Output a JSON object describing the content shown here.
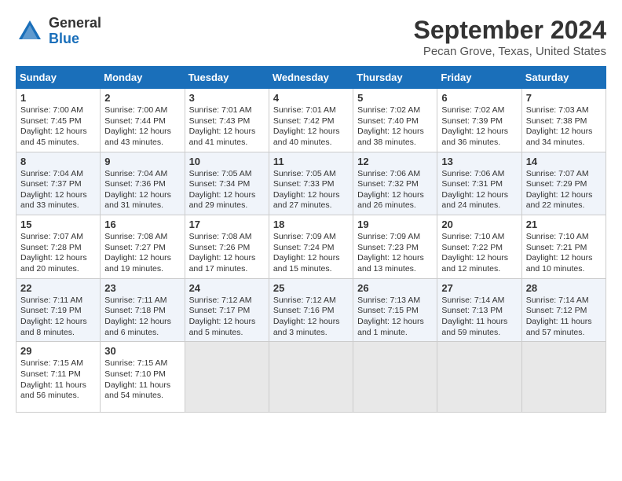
{
  "header": {
    "logo_general": "General",
    "logo_blue": "Blue",
    "title": "September 2024",
    "subtitle": "Pecan Grove, Texas, United States"
  },
  "weekdays": [
    "Sunday",
    "Monday",
    "Tuesday",
    "Wednesday",
    "Thursday",
    "Friday",
    "Saturday"
  ],
  "weeks": [
    [
      {
        "day": "1",
        "lines": [
          "Sunrise: 7:00 AM",
          "Sunset: 7:45 PM",
          "Daylight: 12 hours",
          "and 45 minutes."
        ]
      },
      {
        "day": "2",
        "lines": [
          "Sunrise: 7:00 AM",
          "Sunset: 7:44 PM",
          "Daylight: 12 hours",
          "and 43 minutes."
        ]
      },
      {
        "day": "3",
        "lines": [
          "Sunrise: 7:01 AM",
          "Sunset: 7:43 PM",
          "Daylight: 12 hours",
          "and 41 minutes."
        ]
      },
      {
        "day": "4",
        "lines": [
          "Sunrise: 7:01 AM",
          "Sunset: 7:42 PM",
          "Daylight: 12 hours",
          "and 40 minutes."
        ]
      },
      {
        "day": "5",
        "lines": [
          "Sunrise: 7:02 AM",
          "Sunset: 7:40 PM",
          "Daylight: 12 hours",
          "and 38 minutes."
        ]
      },
      {
        "day": "6",
        "lines": [
          "Sunrise: 7:02 AM",
          "Sunset: 7:39 PM",
          "Daylight: 12 hours",
          "and 36 minutes."
        ]
      },
      {
        "day": "7",
        "lines": [
          "Sunrise: 7:03 AM",
          "Sunset: 7:38 PM",
          "Daylight: 12 hours",
          "and 34 minutes."
        ]
      }
    ],
    [
      {
        "day": "8",
        "lines": [
          "Sunrise: 7:04 AM",
          "Sunset: 7:37 PM",
          "Daylight: 12 hours",
          "and 33 minutes."
        ]
      },
      {
        "day": "9",
        "lines": [
          "Sunrise: 7:04 AM",
          "Sunset: 7:36 PM",
          "Daylight: 12 hours",
          "and 31 minutes."
        ]
      },
      {
        "day": "10",
        "lines": [
          "Sunrise: 7:05 AM",
          "Sunset: 7:34 PM",
          "Daylight: 12 hours",
          "and 29 minutes."
        ]
      },
      {
        "day": "11",
        "lines": [
          "Sunrise: 7:05 AM",
          "Sunset: 7:33 PM",
          "Daylight: 12 hours",
          "and 27 minutes."
        ]
      },
      {
        "day": "12",
        "lines": [
          "Sunrise: 7:06 AM",
          "Sunset: 7:32 PM",
          "Daylight: 12 hours",
          "and 26 minutes."
        ]
      },
      {
        "day": "13",
        "lines": [
          "Sunrise: 7:06 AM",
          "Sunset: 7:31 PM",
          "Daylight: 12 hours",
          "and 24 minutes."
        ]
      },
      {
        "day": "14",
        "lines": [
          "Sunrise: 7:07 AM",
          "Sunset: 7:29 PM",
          "Daylight: 12 hours",
          "and 22 minutes."
        ]
      }
    ],
    [
      {
        "day": "15",
        "lines": [
          "Sunrise: 7:07 AM",
          "Sunset: 7:28 PM",
          "Daylight: 12 hours",
          "and 20 minutes."
        ]
      },
      {
        "day": "16",
        "lines": [
          "Sunrise: 7:08 AM",
          "Sunset: 7:27 PM",
          "Daylight: 12 hours",
          "and 19 minutes."
        ]
      },
      {
        "day": "17",
        "lines": [
          "Sunrise: 7:08 AM",
          "Sunset: 7:26 PM",
          "Daylight: 12 hours",
          "and 17 minutes."
        ]
      },
      {
        "day": "18",
        "lines": [
          "Sunrise: 7:09 AM",
          "Sunset: 7:24 PM",
          "Daylight: 12 hours",
          "and 15 minutes."
        ]
      },
      {
        "day": "19",
        "lines": [
          "Sunrise: 7:09 AM",
          "Sunset: 7:23 PM",
          "Daylight: 12 hours",
          "and 13 minutes."
        ]
      },
      {
        "day": "20",
        "lines": [
          "Sunrise: 7:10 AM",
          "Sunset: 7:22 PM",
          "Daylight: 12 hours",
          "and 12 minutes."
        ]
      },
      {
        "day": "21",
        "lines": [
          "Sunrise: 7:10 AM",
          "Sunset: 7:21 PM",
          "Daylight: 12 hours",
          "and 10 minutes."
        ]
      }
    ],
    [
      {
        "day": "22",
        "lines": [
          "Sunrise: 7:11 AM",
          "Sunset: 7:19 PM",
          "Daylight: 12 hours",
          "and 8 minutes."
        ]
      },
      {
        "day": "23",
        "lines": [
          "Sunrise: 7:11 AM",
          "Sunset: 7:18 PM",
          "Daylight: 12 hours",
          "and 6 minutes."
        ]
      },
      {
        "day": "24",
        "lines": [
          "Sunrise: 7:12 AM",
          "Sunset: 7:17 PM",
          "Daylight: 12 hours",
          "and 5 minutes."
        ]
      },
      {
        "day": "25",
        "lines": [
          "Sunrise: 7:12 AM",
          "Sunset: 7:16 PM",
          "Daylight: 12 hours",
          "and 3 minutes."
        ]
      },
      {
        "day": "26",
        "lines": [
          "Sunrise: 7:13 AM",
          "Sunset: 7:15 PM",
          "Daylight: 12 hours",
          "and 1 minute."
        ]
      },
      {
        "day": "27",
        "lines": [
          "Sunrise: 7:14 AM",
          "Sunset: 7:13 PM",
          "Daylight: 11 hours",
          "and 59 minutes."
        ]
      },
      {
        "day": "28",
        "lines": [
          "Sunrise: 7:14 AM",
          "Sunset: 7:12 PM",
          "Daylight: 11 hours",
          "and 57 minutes."
        ]
      }
    ],
    [
      {
        "day": "29",
        "lines": [
          "Sunrise: 7:15 AM",
          "Sunset: 7:11 PM",
          "Daylight: 11 hours",
          "and 56 minutes."
        ]
      },
      {
        "day": "30",
        "lines": [
          "Sunrise: 7:15 AM",
          "Sunset: 7:10 PM",
          "Daylight: 11 hours",
          "and 54 minutes."
        ]
      },
      null,
      null,
      null,
      null,
      null
    ]
  ]
}
